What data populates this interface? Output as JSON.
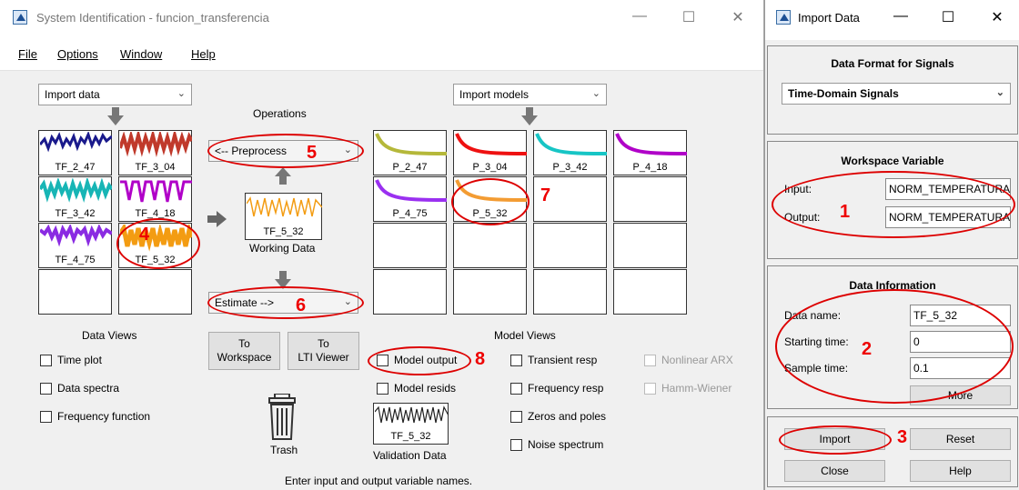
{
  "main_window": {
    "title": "System Identification - funcion_transferencia",
    "controls": {
      "minimize": "—",
      "maximize": "☐",
      "close": "✕"
    },
    "menu": [
      "File",
      "Options",
      "Window",
      "Help"
    ],
    "import_data": "Import data",
    "import_models": "Import models",
    "operations_label": "Operations",
    "preprocess": "<-- Preprocess",
    "estimate": "Estimate -->",
    "working_data_tile": "TF_5_32",
    "working_data_label": "Working Data",
    "data_tiles": [
      "TF_2_47",
      "TF_3_04",
      "TF_3_42",
      "TF_4_18",
      "TF_4_75",
      "TF_5_32"
    ],
    "model_tiles": [
      "P_2_47",
      "P_3_04",
      "P_3_42",
      "P_4_18",
      "P_4_75",
      "P_5_32"
    ],
    "data_views_label": "Data Views",
    "data_views": [
      "Time plot",
      "Data spectra",
      "Frequency function"
    ],
    "to_workspace": [
      "To",
      "Workspace"
    ],
    "to_lti": [
      "To",
      "LTI Viewer"
    ],
    "trash_label": "Trash",
    "validation_tile": "TF_5_32",
    "validation_label": "Validation Data",
    "model_views_label": "Model Views",
    "model_views_col1": [
      "Model output",
      "Model resids"
    ],
    "model_views_col2": [
      "Transient resp",
      "Frequency resp",
      "Zeros and poles",
      "Noise spectrum"
    ],
    "model_views_col3": [
      "Nonlinear ARX",
      "Hamm-Wiener"
    ],
    "status": "Enter input and output variable names."
  },
  "import_window": {
    "title": "Import Data",
    "data_format_heading": "Data Format for Signals",
    "data_format_value": "Time-Domain Signals",
    "workspace_heading": "Workspace Variable",
    "input_label": "Input:",
    "input_value": "NORM_TEMPERATURA",
    "output_label": "Output:",
    "output_value": "NORM_TEMPERATURA",
    "data_info_heading": "Data Information",
    "data_name_label": "Data name:",
    "data_name_value": "TF_5_32",
    "start_label": "Starting time:",
    "start_value": "0",
    "sample_label": "Sample time:",
    "sample_value": "0.1",
    "more": "More",
    "import": "Import",
    "reset": "Reset",
    "close": "Close",
    "help": "Help"
  },
  "annotations": [
    "1",
    "2",
    "3",
    "4",
    "5",
    "6",
    "7",
    "8"
  ],
  "colors": {
    "annotation": "#dd0000",
    "tf247": "#1a1a8c",
    "tf304": "#c0392b",
    "tf342": "#17b5b5",
    "tf418": "#b000c8",
    "tf475": "#8a2be2",
    "tf532": "#f39c12"
  }
}
